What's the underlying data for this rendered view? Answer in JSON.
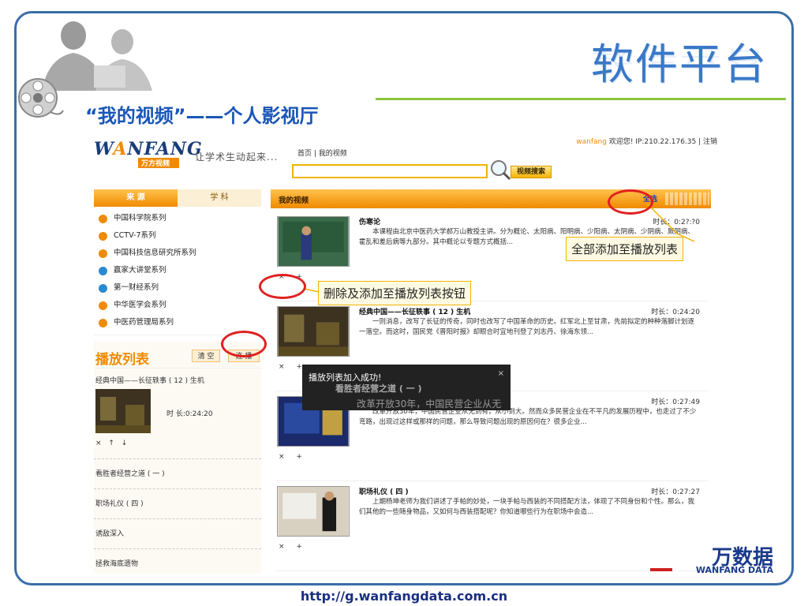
{
  "slide": {
    "title": "软件平台",
    "subtitle": "“我的视频”——个人影视厅",
    "footer_url": "http://g.wanfangdata.com.cn",
    "brand_top": "万数据",
    "brand_bottom": "WANFANG DATA"
  },
  "site": {
    "logo_main_a": "W",
    "logo_main_b": "A",
    "logo_main_c": "NFANG",
    "logo_sub": "万方视频",
    "slogan": "让学术生动起来...",
    "nav": "首页  |  我的视频",
    "search_btn": "视频搜索",
    "user_name": "wanfang",
    "user_greeting": " 欢迎您! IP:210.22.176.35   | 注销"
  },
  "left": {
    "tab_source": "来 源",
    "tab_subject": "学 科",
    "sources": [
      {
        "label": "中国科学院系列",
        "color": "#f08a00"
      },
      {
        "label": "CCTV-7系列",
        "color": "#f08a00"
      },
      {
        "label": "中国科技信息研究所系列",
        "color": "#f08a00"
      },
      {
        "label": "赢家大讲堂系列",
        "color": "#2a8ad0"
      },
      {
        "label": "第一财经系列",
        "color": "#2a8ad0"
      },
      {
        "label": "中华医学会系列",
        "color": "#f08a00"
      },
      {
        "label": "中医药管理局系列",
        "color": "#f08a00"
      }
    ]
  },
  "playlist": {
    "title": "播放列表",
    "clear": "清 空",
    "loop": "连 播",
    "current": "经典中国——长征轶事 ( 12 ) 生机",
    "duration": "时 长:0:24:20",
    "controls": "× ↑ ↓",
    "items": [
      "看胜者经营之道 ( 一 )",
      "职场礼仪 ( 四 )",
      "诱敌深入",
      "拯救海底遗物"
    ]
  },
  "main": {
    "title": "我的视频",
    "select_all": "全选",
    "videos": [
      {
        "title": "伤寒论",
        "duration": "时长：0:2?:?0",
        "desc": "本课程由北京中医药大学郝万山教授主讲。分为概论、太阳病、阳明病、少阳病、太阴病、少阴病、厥阴病、霍乱和差后病等九部分。其中概论以专题方式概括...",
        "actions": "× +"
      },
      {
        "title": "经典中国——长征轶事 ( 12 ) 生机",
        "duration": "时长：0:24:20",
        "desc": "一则消息，改写了长征的传奇，同时也改写了中国革命的历史。红军北上至甘肃，先前拟定的种种落脚计划逐一落空。而这时，国民党《晋阳时报》却眼合时宜地刊登了刘志丹、徐海东领...",
        "actions": "× +"
      },
      {
        "title": "看胜者经营之道 ( 一 )",
        "duration": "时长：0:27:49",
        "desc": "改革开放30年，中国民营企业从无到有，从小到大。然而众多民营企业在不平凡的发展历程中，也走过了不少弯路，出现过这样或那样的问题，那么导致问题出现的原因何在？很多企业...",
        "actions": "× +"
      },
      {
        "title": "职场礼仪 ( 四 )",
        "duration": "时长：0:27:27",
        "desc": "上期杨坤老师为我们讲述了手帕的妙处，一块手帕与西装的不同搭配方法，体现了不同身份和个性。那么，我们其他的一些随身物品，又如何与西装搭配呢？你知道哪些行为在职场中会造...",
        "actions": "× +"
      }
    ]
  },
  "toast": {
    "message": "播放列表加入成功!",
    "close": "×",
    "ghost_title": "看胜者经营之道 ( 一 )",
    "ghost_desc": "改革开放30年，中国民营企业从无"
  },
  "callouts": {
    "add_all": "全部添加至播放列表",
    "delete_add": "删除及添加至播放列表按钮"
  },
  "colors": {
    "accent": "#f08a00",
    "frame": "#3b6ea8",
    "title_blue": "#3a78c8"
  }
}
